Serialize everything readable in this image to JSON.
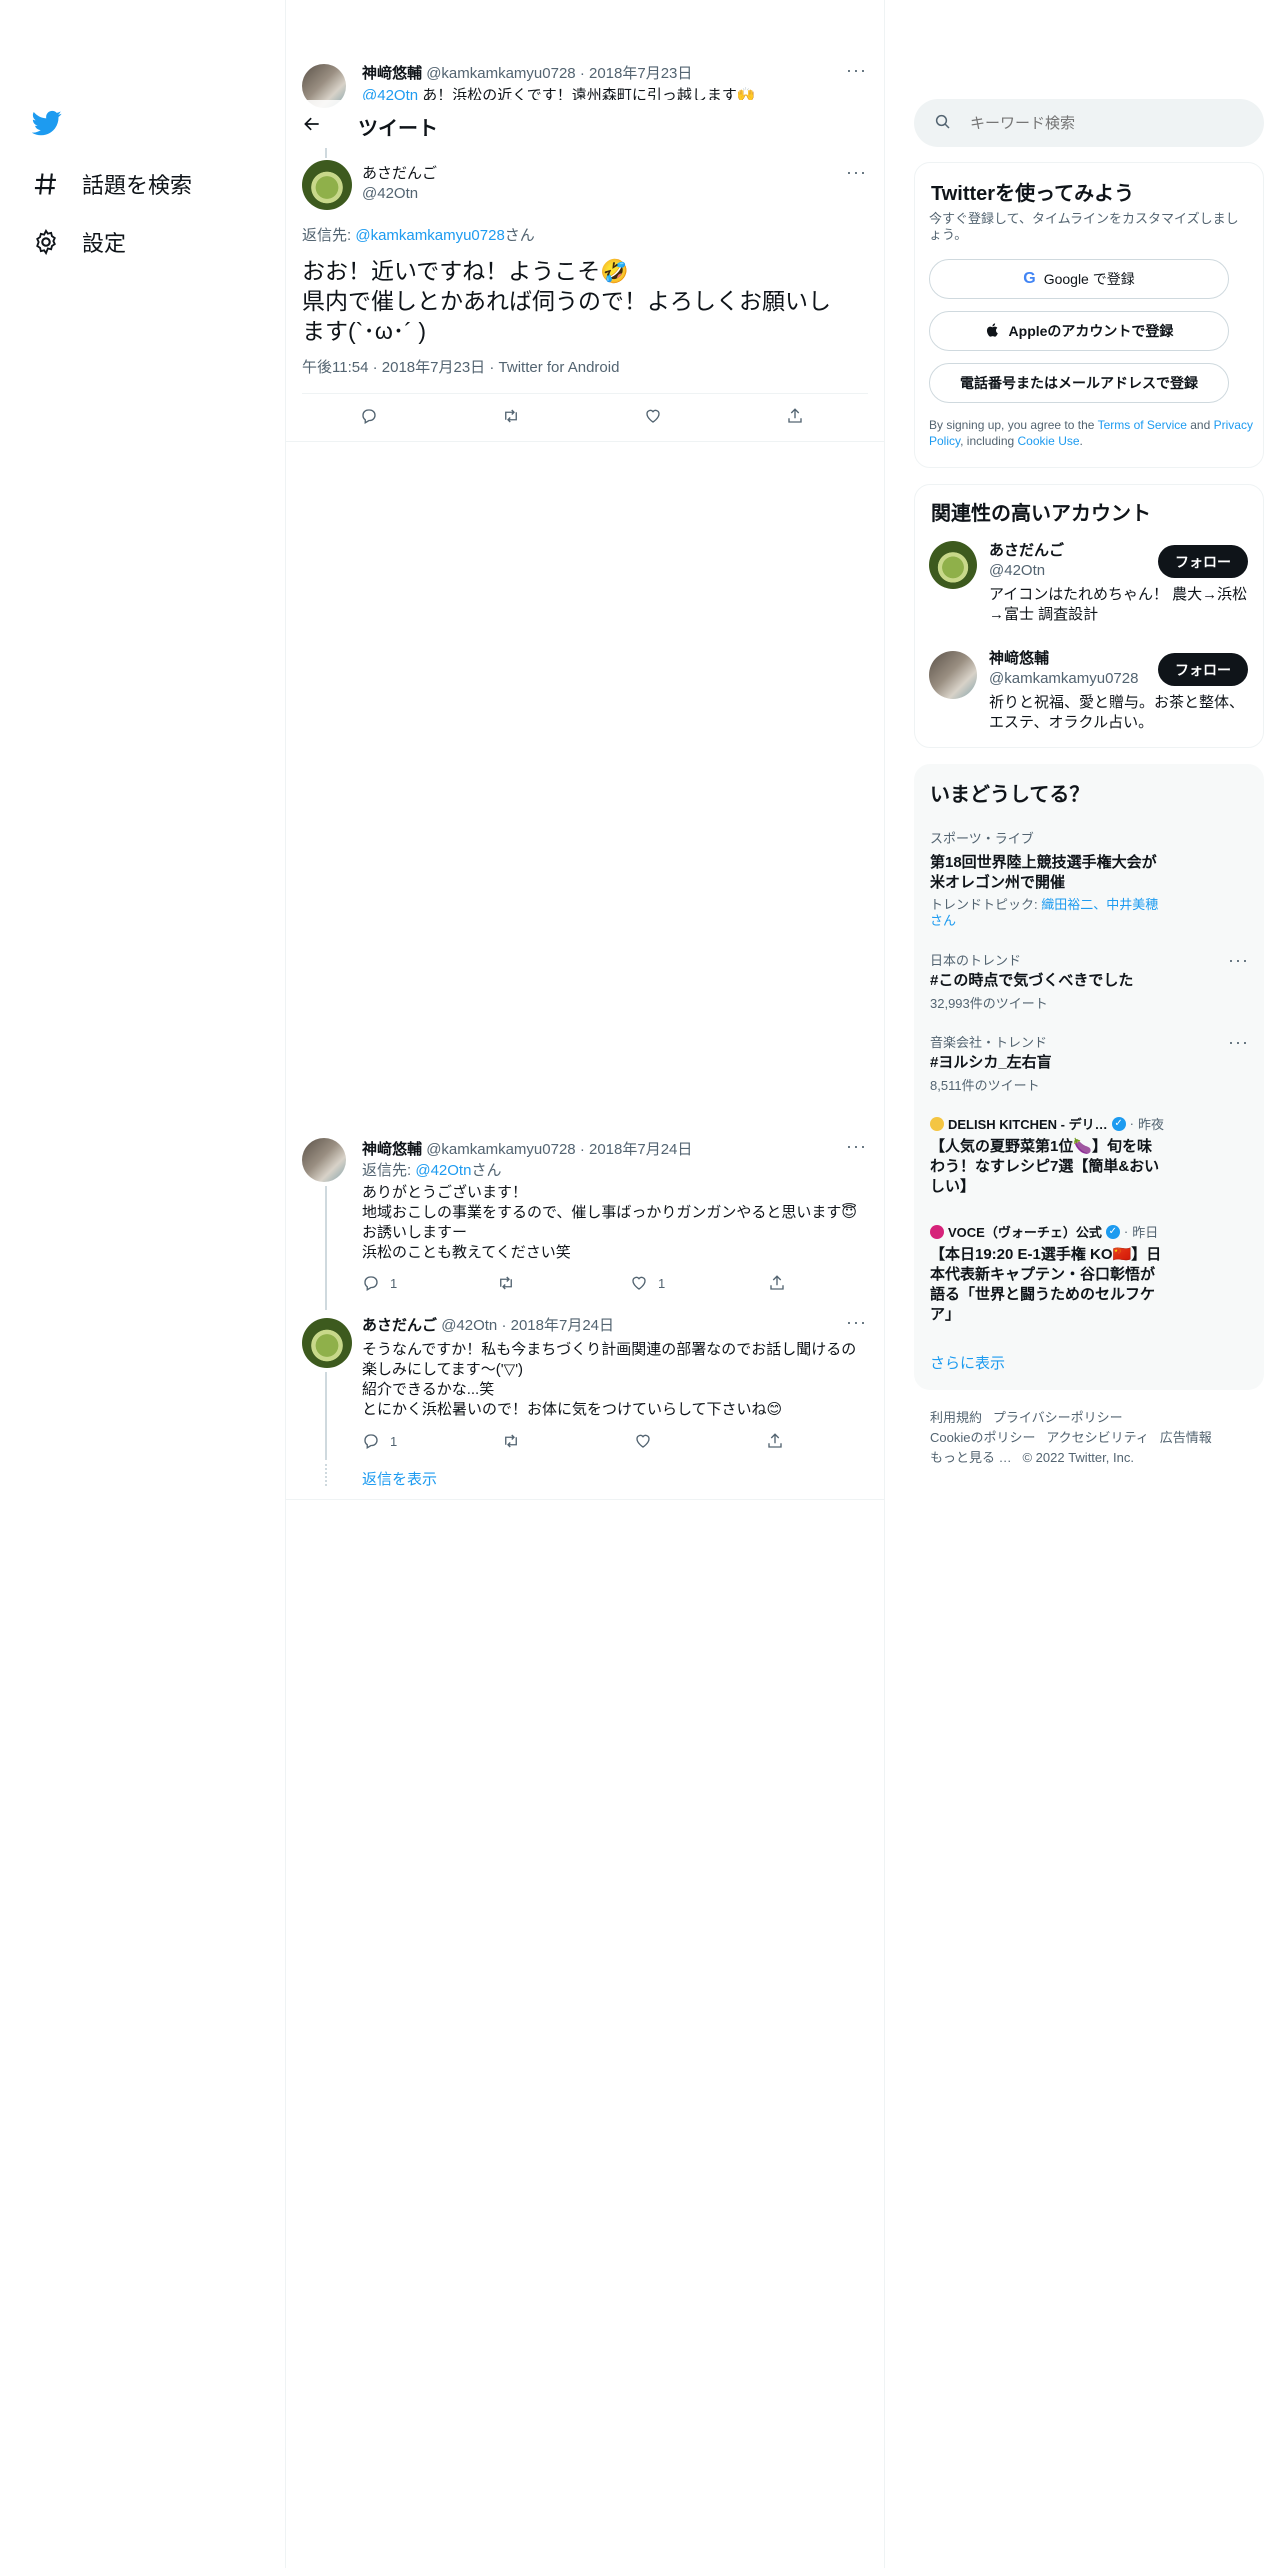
{
  "nav": {
    "explore_label": "話題を検索",
    "settings_label": "設定"
  },
  "prev_tweet": {
    "name": "神﨑悠輔",
    "handle": "@kamkamkamyu0728",
    "date": "2018年7月23日",
    "text_mention": "@42Otn",
    "text_rest": " あ！浜松の近くです！遠州森町に引っ越します🙌"
  },
  "header": {
    "title": "ツイート"
  },
  "main_tweet": {
    "name": "あさだんご",
    "handle": "@42Otn",
    "reply_prefix": "返信先: ",
    "reply_to": "@kamkamkamyu0728",
    "reply_suffix": "さん",
    "line1": "おお！近いですね！ようこそ🤣",
    "line2": "県内で催しとかあれば伺うので！よろしくお願いし",
    "line3": "ます(`･ω･´ )",
    "time": "午後11:54",
    "date": "2018年7月23日",
    "client": "Twitter for Android"
  },
  "reply1": {
    "name": "神﨑悠輔",
    "handle": "@kamkamkamyu0728",
    "date": "2018年7月24日",
    "reply_prefix": "返信先: ",
    "reply_to": "@42Otn",
    "reply_suffix": "さん",
    "line1": "ありがとうございます！",
    "line2": "地域おこしの事業をするので、催し事ばっかりガンガンやると思います😇",
    "line3": "お誘いしますー",
    "line4": "浜松のことも教えてください笑",
    "reply_count": "1",
    "like_count": "1"
  },
  "reply2": {
    "name": "あさだんご",
    "handle": "@42Otn",
    "date": "2018年7月24日",
    "line1": "そうなんですか！私も今まちづくり計画関連の部署なのでお話し聞けるの",
    "line2": "楽しみにしてます～('▽')",
    "line3": "紹介できるかな...笑",
    "line4": "とにかく浜松暑いので！お体に気をつけていらして下さいね😊",
    "reply_count": "1",
    "show_replies": "返信を表示"
  },
  "search": {
    "placeholder": "キーワード検索"
  },
  "signup": {
    "title": "Twitterを使ってみよう",
    "subtitle": "今すぐ登録して、タイムラインをカスタマイズしましょう。",
    "google_label": "Google で登録",
    "apple_label": "Appleのアカウントで登録",
    "phone_label": "電話番号またはメールアドレスで登録",
    "legal_1": "By signing up, you agree to the ",
    "legal_tos": "Terms of Service",
    "legal_2": " and ",
    "legal_pp": "Privacy Policy",
    "legal_3": ", including ",
    "legal_cookie": "Cookie Use",
    "legal_4": "."
  },
  "related": {
    "title": "関連性の高いアカウント",
    "follow_label": "フォロー",
    "accounts": [
      {
        "name": "あさだんご",
        "handle": "@42Otn",
        "bio": "アイコンはたれめちゃん！ 農大→浜松→富士 調査設計"
      },
      {
        "name": "神﨑悠輔",
        "handle": "@kamkamkamyu0728",
        "bio": "祈りと祝福、愛と贈与。お茶と整体、エステ、オラクル占い。"
      }
    ]
  },
  "trends": {
    "title": "いまどうしてる？",
    "items": [
      {
        "category": "スポーツ・ライブ",
        "title_1": "第18回世界陸上競技選手権大会が",
        "title_2": "米オレゴン州で開催",
        "topic_prefix": "トレンドトピック: ",
        "topic_1": "織田裕二、中井美穂",
        "topic_2": "さん"
      },
      {
        "category": "日本のトレンド",
        "title": "#この時点で気づくべきでした",
        "count": "32,993件のツイート"
      },
      {
        "category": "音楽会社・トレンド",
        "title": "#ヨルシカ_左右盲",
        "count": "8,511件のツイート"
      },
      {
        "source": "DELISH KITCHEN - デリ…",
        "time": "昨夜",
        "title_1": "【人気の夏野菜第1位🍆】旬を味",
        "title_2": "わう！なすレシピ7選【簡単&おい",
        "title_3": "しい】"
      },
      {
        "source": "VOCE（ヴォーチェ）公式",
        "time": "昨日",
        "title_1": "【本日19:20 E-1選手権 KO🇨🇳】日",
        "title_2": "本代表新キャプテン・谷口彰悟が",
        "title_3": "語る「世界と闘うためのセルフケ",
        "title_4": "ア」"
      }
    ],
    "show_more": "さらに表示"
  },
  "footer": {
    "terms": "利用規約",
    "privacy": "プライバシーポリシー",
    "cookie": "Cookieのポリシー",
    "accessibility": "アクセシビリティ",
    "ads": "広告情報",
    "more": "もっと見る …",
    "copyright": "© 2022 Twitter, Inc."
  },
  "colors": {
    "accent": "#1d9bf0",
    "text": "#0f1419",
    "muted": "#536471",
    "border": "#eff3f4",
    "sidebar_bg": "#f7f9f9"
  }
}
